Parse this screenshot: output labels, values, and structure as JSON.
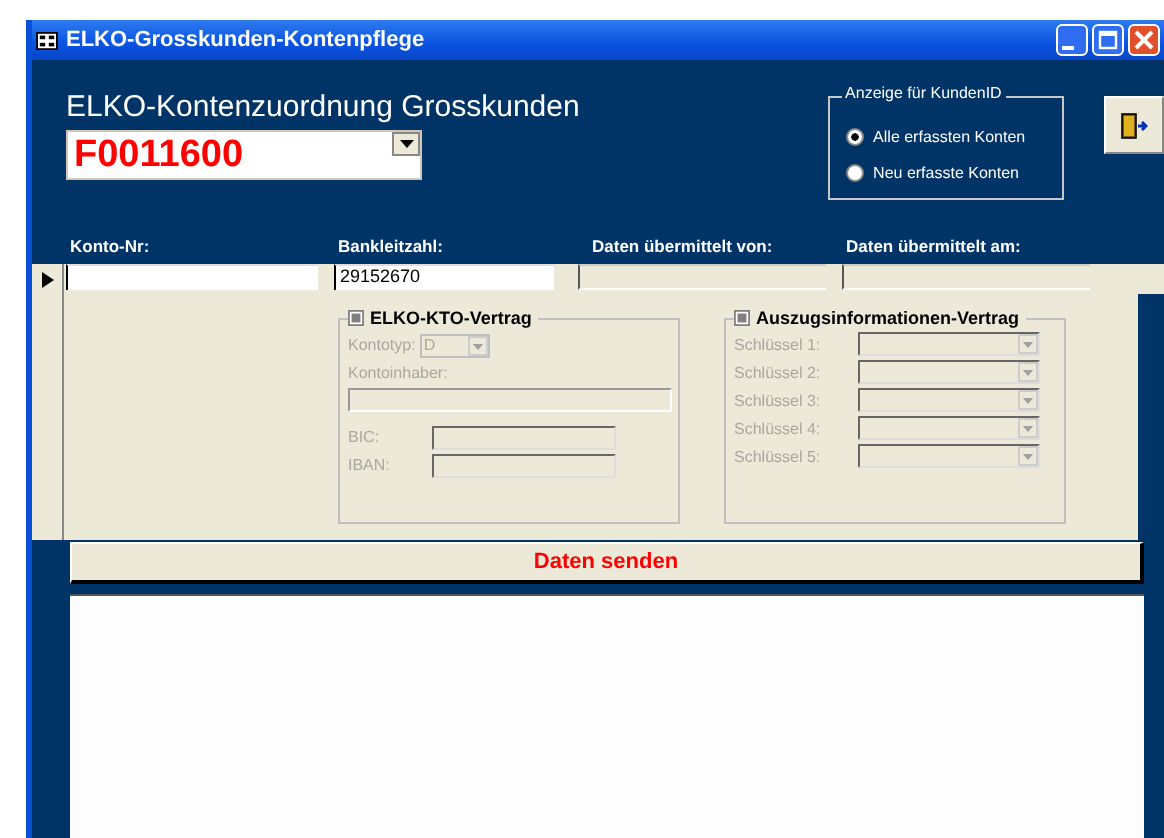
{
  "window": {
    "title": "ELKO-Grosskunden-Kontenpflege"
  },
  "header": {
    "title": "ELKO-Kontenzuordnung Grosskunden",
    "customer_id": "F0011600"
  },
  "display_filter": {
    "legend": "Anzeige für KundenID",
    "options": [
      {
        "label": "Alle erfassten Konten",
        "selected": true
      },
      {
        "label": "Neu erfasste Konten",
        "selected": false
      }
    ]
  },
  "fields": [
    {
      "label": "Konto-Nr:",
      "kind": "input"
    },
    {
      "label": "Bankleitzahl:",
      "kind": "input",
      "value": "29152670"
    },
    {
      "label": "Daten übermittelt von:",
      "kind": "readonly"
    },
    {
      "label": "Daten übermittelt am:",
      "kind": "readonly"
    }
  ],
  "kto_contract": {
    "title": "ELKO-KTO-Vertrag",
    "disabled": true,
    "account_type_label": "Kontotyp:",
    "account_type": "D",
    "holder_label": "Kontoinhaber:",
    "bic_label": "BIC:",
    "iban_label": "IBAN:"
  },
  "statement_contract": {
    "title": "Auszugsinformationen-Vertrag",
    "disabled": true,
    "keys": [
      {
        "label": "Schlüssel 1:"
      },
      {
        "label": "Schlüssel 2:"
      },
      {
        "label": "Schlüssel 3:"
      },
      {
        "label": "Schlüssel 4:"
      },
      {
        "label": "Schlüssel 5:"
      }
    ]
  },
  "send_button": {
    "label": "Daten senden"
  }
}
